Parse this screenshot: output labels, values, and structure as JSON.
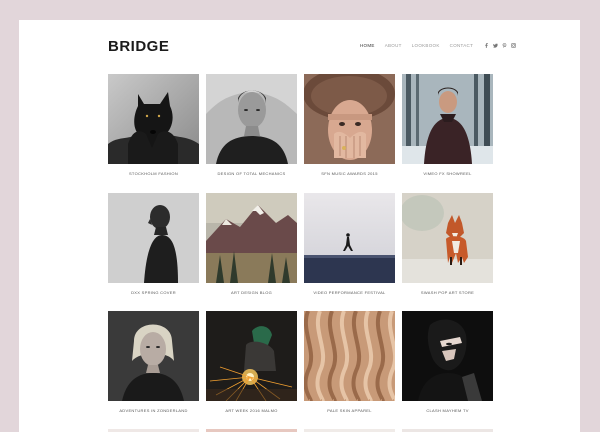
{
  "header": {
    "logo": "BRIDGE",
    "nav": [
      "HOME",
      "ABOUT",
      "LOOKBOOK",
      "CONTACT"
    ],
    "social_icons": [
      "facebook-icon",
      "twitter-icon",
      "pinterest-icon",
      "instagram-icon"
    ]
  },
  "portfolio": {
    "items": [
      {
        "caption": "STOCKHOLM FASHION",
        "image": "black-wolf"
      },
      {
        "caption": "DESIGN OF TOTAL MECHANICS",
        "image": "woman-wet-hair"
      },
      {
        "caption": "SFN MUSIC AWARDS 2015",
        "image": "woman-fur-hat"
      },
      {
        "caption": "VIMEO FX SHOWREEL",
        "image": "man-in-snowy-forest"
      },
      {
        "caption": "DXX SPRING COVER",
        "image": "bald-man-profile"
      },
      {
        "caption": "ART DESIGN BLOG",
        "image": "mountain-landscape"
      },
      {
        "caption": "VIDEO PERFORMANCE FESTIVAL",
        "image": "person-walking-beach"
      },
      {
        "caption": "SWASH POP ART STORE",
        "image": "red-fox"
      },
      {
        "caption": "ADVENTURES IN ZONDERLAND",
        "image": "blonde-woman-portrait"
      },
      {
        "caption": "ART WEEK 2016 MALMO",
        "image": "welder-sparks"
      },
      {
        "caption": "PALE SKIN APPAREL",
        "image": "wavy-wood-texture"
      },
      {
        "caption": "CLASH MAYHEM TV",
        "image": "woman-shadow-face"
      }
    ]
  }
}
